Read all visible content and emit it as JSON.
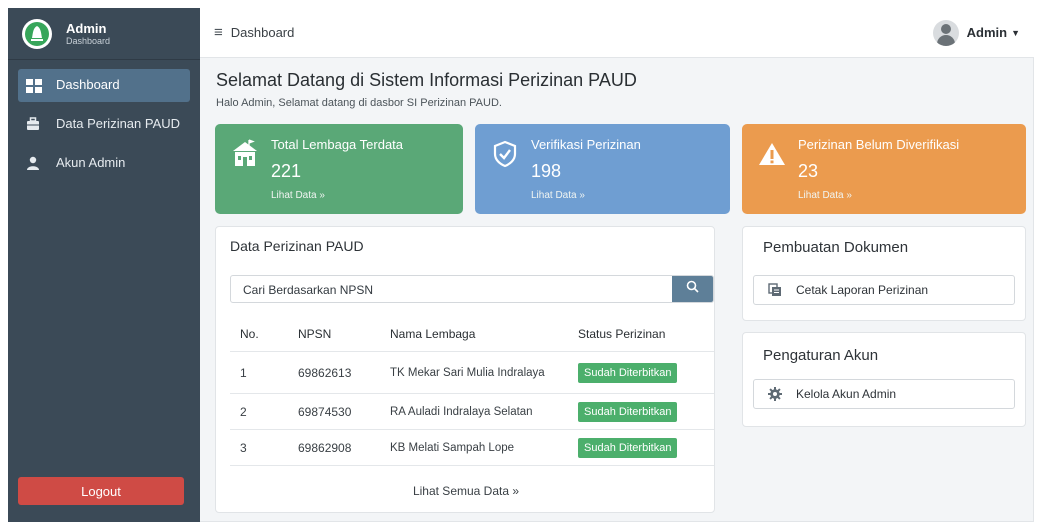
{
  "sidebar": {
    "brand_title": "Admin",
    "brand_sub": "Dashboard",
    "items": [
      {
        "label": "Dashboard",
        "icon": "grid-icon",
        "active": true
      },
      {
        "label": "Data Perizinan PAUD",
        "icon": "briefcase-icon",
        "active": false
      },
      {
        "label": "Akun Admin",
        "icon": "user-icon",
        "active": false
      }
    ],
    "logout_label": "Logout"
  },
  "topbar": {
    "breadcrumb": "Dashboard",
    "user_name": "Admin"
  },
  "main": {
    "title": "Selamat Datang di Sistem Informasi Perizinan PAUD",
    "subtitle": "Halo Admin, Selamat datang di dasbor SI Perizinan PAUD.",
    "stats": [
      {
        "title": "Total Lembaga Terdata",
        "value": "221",
        "link": "Lihat Data »",
        "color": "#5aa877",
        "icon": "school-icon"
      },
      {
        "title": "Verifikasi Perizinan",
        "value": "198",
        "link": "Lihat Data »",
        "color": "#6f9ed2",
        "icon": "shield-check-icon"
      },
      {
        "title": "Perizinan Belum Diverifikasi",
        "value": "23",
        "link": "Lihat Data »",
        "color": "#eb9b4e",
        "icon": "warning-icon"
      }
    ],
    "table_card": {
      "title": "Data Perizinan PAUD",
      "search_placeholder": "Cari Berdasarkan NPSN",
      "columns": [
        "No.",
        "NPSN",
        "Nama Lembaga",
        "Status Perizinan"
      ],
      "rows": [
        {
          "no": "1",
          "npsn": "69862613",
          "nama": "TK Mekar Sari Mulia Indralaya",
          "status": "Sudah Diterbitkan"
        },
        {
          "no": "2",
          "npsn": "69874530",
          "nama": "RA Auladi Indralaya Selatan",
          "status": "Sudah Diterbitkan"
        },
        {
          "no": "3",
          "npsn": "69862908",
          "nama": "KB Melati Sampah Lope",
          "status": "Sudah Diterbitkan"
        }
      ],
      "see_all": "Lihat Semua Data »"
    },
    "doc_card": {
      "title": "Pembuatan Dokumen",
      "action": "Cetak Laporan Perizinan"
    },
    "account_card": {
      "title": "Pengaturan Akun",
      "action": "Kelola Akun Admin"
    }
  },
  "colors": {
    "sidebar": "#3b4a57",
    "active_nav": "#52718b",
    "logout": "#cf4b45",
    "badge": "#4caf6c",
    "search_button": "#5e7f98"
  }
}
